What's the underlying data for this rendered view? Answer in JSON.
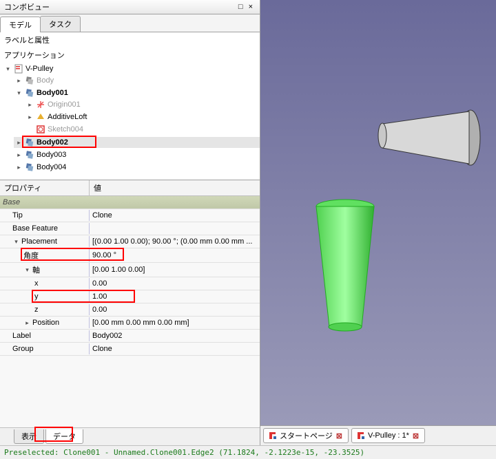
{
  "panel": {
    "title": "コンボビュー",
    "dock_icon": "□",
    "close_icon": "×"
  },
  "top_tabs": [
    {
      "label": "モデル",
      "active": true
    },
    {
      "label": "タスク",
      "active": false
    }
  ],
  "tree": {
    "label_attrs": "ラベルと属性",
    "application": "アプリケーション",
    "root": "V-Pulley",
    "items": [
      {
        "label": "Body",
        "dim": true
      },
      {
        "label": "Body001",
        "bold": true,
        "expanded": true,
        "children": [
          {
            "label": "Origin001",
            "dim": true
          },
          {
            "label": "AdditiveLoft"
          },
          {
            "label": "Sketch004",
            "dim": true
          }
        ]
      },
      {
        "label": "Body002",
        "selected": true,
        "highlight": true
      },
      {
        "label": "Body003"
      },
      {
        "label": "Body004"
      }
    ]
  },
  "props": {
    "header_name": "プロパティ",
    "header_value": "値",
    "section": "Base",
    "rows": [
      {
        "name": "Tip",
        "value": "Clone",
        "indent": 1
      },
      {
        "name": "Base Feature",
        "value": "",
        "indent": 1
      },
      {
        "name": "Placement",
        "value": "[(0.00 1.00 0.00); 90.00 °; (0.00 mm  0.00 mm  ...",
        "indent": 1,
        "expander": "v"
      },
      {
        "name": "角度",
        "value": "90.00 °",
        "indent": 2,
        "highlight": true
      },
      {
        "name": "軸",
        "value": "[0.00 1.00 0.00]",
        "indent": 2,
        "expander": "v"
      },
      {
        "name": "x",
        "value": "0.00",
        "indent": 3
      },
      {
        "name": "y",
        "value": "1.00",
        "indent": 3,
        "highlight": true
      },
      {
        "name": "z",
        "value": "0.00",
        "indent": 3
      },
      {
        "name": "Position",
        "value": "[0.00 mm  0.00 mm  0.00 mm]",
        "indent": 2,
        "expander": ">"
      },
      {
        "name": "Label",
        "value": "Body002",
        "indent": 1
      },
      {
        "name": "Group",
        "value": "Clone",
        "indent": 1
      }
    ]
  },
  "bottom_tabs": [
    {
      "label": "表示",
      "active": false
    },
    {
      "label": "データ",
      "active": true,
      "highlight": true
    }
  ],
  "doc_tabs": [
    {
      "label": "スタートページ"
    },
    {
      "label": "V-Pulley : 1*"
    }
  ],
  "status": "Preselected: Clone001 - Unnamed.Clone001.Edge2 (71.1824, -2.1223e-15, -23.3525)"
}
